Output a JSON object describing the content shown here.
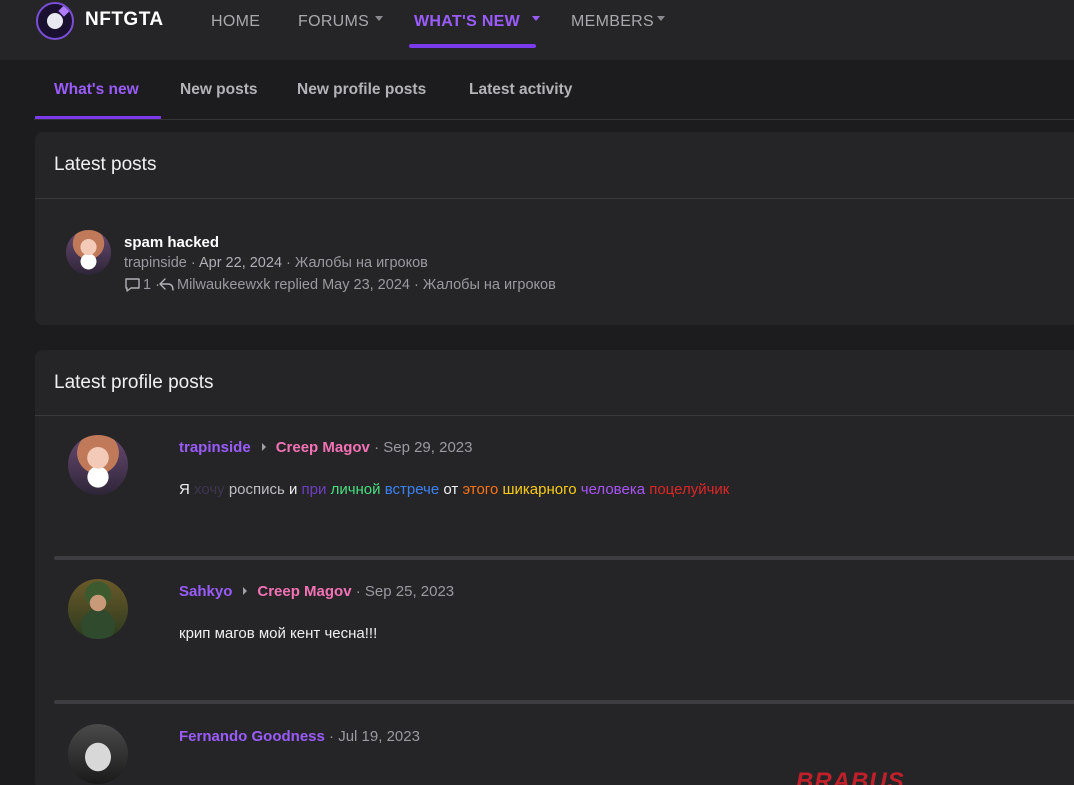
{
  "header": {
    "brand": "NFTGTA",
    "nav": [
      {
        "label": "HOME"
      },
      {
        "label": "FORUMS"
      },
      {
        "label": "WHAT'S NEW"
      },
      {
        "label": "MEMBERS"
      }
    ],
    "accent_color": "#7c3aed"
  },
  "subtabs": [
    {
      "label": "What's new"
    },
    {
      "label": "New posts"
    },
    {
      "label": "New profile posts"
    },
    {
      "label": "Latest activity"
    }
  ],
  "latest_posts": {
    "title": "Latest posts",
    "items": [
      {
        "title": "spam hacked",
        "author": "trapinside",
        "date": "Apr 22, 2024",
        "forum": "Жалобы на игроков",
        "replies": "1",
        "last_replier": "Milwaukeewxk",
        "replied_word": "replied",
        "last_date": "May 23, 2024",
        "last_forum": "Жалобы на игроков"
      }
    ]
  },
  "latest_profile_posts": {
    "title": "Latest profile posts",
    "items": [
      {
        "author": "trapinside",
        "target": "Creep Magov",
        "date": "Sep 29, 2023",
        "text_parts": [
          "Я ",
          "хочу ",
          "роспись ",
          "и ",
          "при ",
          "личной ",
          "встрече ",
          "от ",
          "этого ",
          "шикарного ",
          "человека ",
          "поцелуйчик"
        ]
      },
      {
        "author": "Sahkyo",
        "target": "Creep Magov",
        "date": "Sep 25, 2023",
        "text": "крип магов мой кент чесна!!!"
      },
      {
        "author": "Fernando Goodness",
        "date": "Jul 19, 2023",
        "image_text": "BRABUS"
      }
    ]
  }
}
